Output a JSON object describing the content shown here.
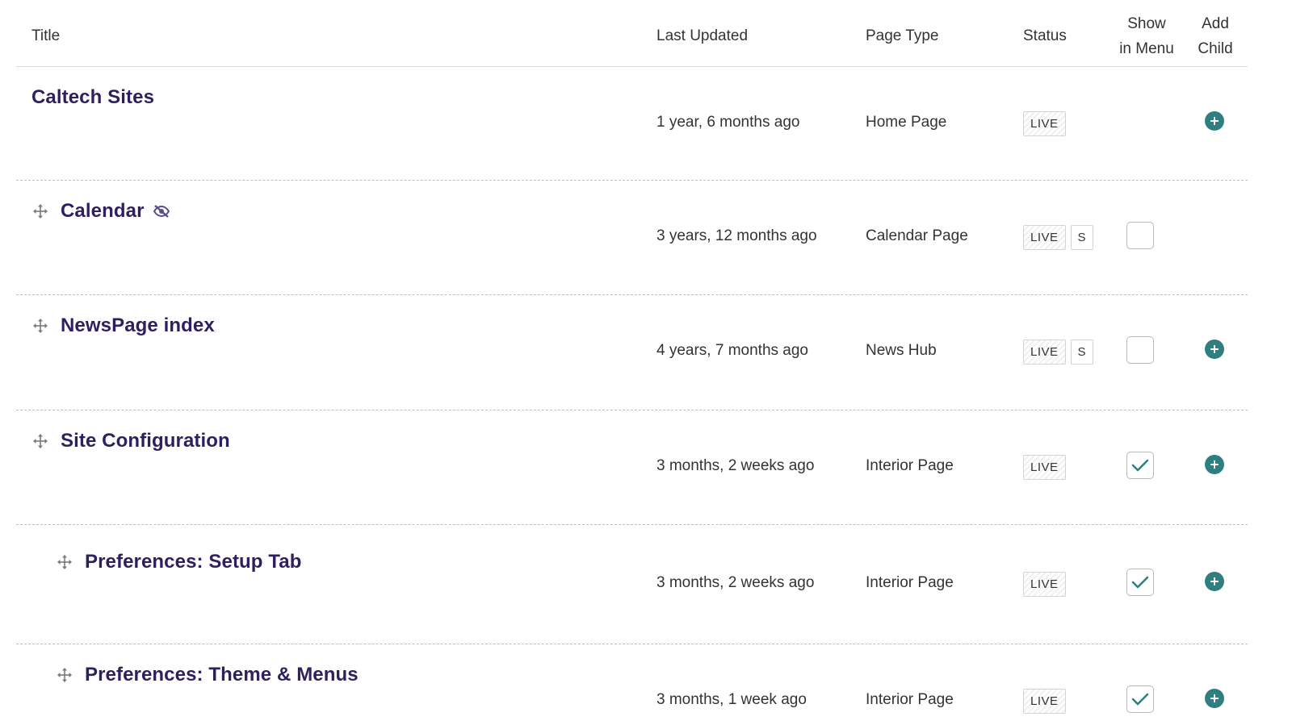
{
  "columns": {
    "title": "Title",
    "last_updated": "Last Updated",
    "page_type": "Page Type",
    "status": "Status",
    "show_in_menu_line1": "Show",
    "show_in_menu_line2": "in Menu",
    "add_child_line1": "Add",
    "add_child_line2": "Child"
  },
  "rows": [
    {
      "title": "Caltech Sites",
      "last_updated": "1 year, 6 months ago",
      "page_type": "Home Page",
      "status": "LIVE",
      "status_extra": "",
      "show_in_menu": null,
      "add_child": true,
      "hidden_icon": false,
      "indent": 0
    },
    {
      "title": "Calendar",
      "last_updated": "3 years, 12 months ago",
      "page_type": "Calendar Page",
      "status": "LIVE",
      "status_extra": "S",
      "show_in_menu": false,
      "add_child": false,
      "hidden_icon": true,
      "indent": 0
    },
    {
      "title": "NewsPage index",
      "last_updated": "4 years, 7 months ago",
      "page_type": "News Hub",
      "status": "LIVE",
      "status_extra": "S",
      "show_in_menu": false,
      "add_child": true,
      "hidden_icon": false,
      "indent": 0
    },
    {
      "title": "Site Configuration",
      "last_updated": "3 months, 2 weeks ago",
      "page_type": "Interior Page",
      "status": "LIVE",
      "status_extra": "",
      "show_in_menu": true,
      "add_child": true,
      "hidden_icon": false,
      "indent": 0
    },
    {
      "title": "Preferences: Setup Tab",
      "last_updated": "3 months, 2 weeks ago",
      "page_type": "Interior Page",
      "status": "LIVE",
      "status_extra": "",
      "show_in_menu": true,
      "add_child": true,
      "hidden_icon": false,
      "indent": 1
    },
    {
      "title": "Preferences: Theme & Menus",
      "last_updated": "3 months, 1 week ago",
      "page_type": "Interior Page",
      "status": "LIVE",
      "status_extra": "",
      "show_in_menu": true,
      "add_child": true,
      "hidden_icon": false,
      "indent": 1
    }
  ],
  "colors": {
    "title": "#2e1f5e",
    "accent": "#2f7f80",
    "text": "#333333"
  },
  "icons": {
    "drag": "drag-handle-icon",
    "hidden": "eye-slash-icon",
    "check": "checkmark-icon",
    "add": "plus-circle-icon"
  }
}
